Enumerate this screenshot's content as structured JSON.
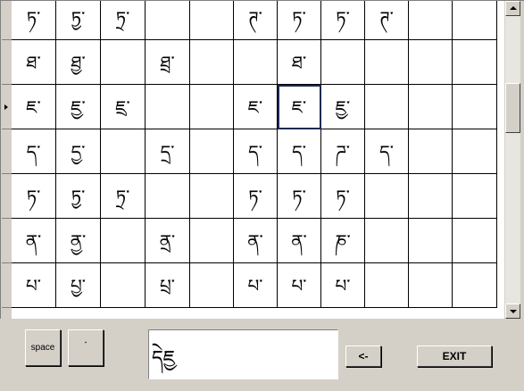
{
  "grid": {
    "rows": [
      [
        "ཏ་",
        "ཏྱ་",
        "ཏྲ་",
        "",
        "",
        "ཊ་",
        "ཏ་",
        "ཏ་",
        "ཊ་",
        "",
        ""
      ],
      [
        "ཐ་",
        "ཐྱ་",
        "",
        "ཐྲ་",
        "",
        "",
        "ཐ་",
        "",
        "",
        "",
        ""
      ],
      [
        "ཇ་",
        "ཇྱ་",
        "ཇྲ་",
        "",
        "",
        "ཇ་",
        "ཇ་",
        "ཇྱ་",
        "",
        "",
        ""
      ],
      [
        "ད་",
        "དྱ་",
        "",
        "དྲ་",
        "",
        "ད་",
        "ད་",
        "ཌ་",
        "ད་",
        "",
        ""
      ],
      [
        "ཏ་",
        "ཏྱ་",
        "ཏྲ་",
        "",
        "",
        "ཏ་",
        "ཏ་",
        "ཏ་",
        "",
        "",
        ""
      ],
      [
        "ན་",
        "ནྱ་",
        "",
        "ནྲ་",
        "",
        "ན་",
        "ན་",
        "ཎ་",
        "",
        "",
        ""
      ],
      [
        "པ་",
        "པྱ་",
        "",
        "པྲ་",
        "",
        "པ་",
        "པ་",
        "པ་",
        "",
        "",
        ""
      ]
    ],
    "selected_row": 2,
    "selected_col": 6
  },
  "buttons": {
    "space_label": "space",
    "tsheg_label": "་",
    "back_label": "<-",
    "exit_label": "EXIT"
  },
  "output": {
    "text": "དེཇྱ"
  }
}
